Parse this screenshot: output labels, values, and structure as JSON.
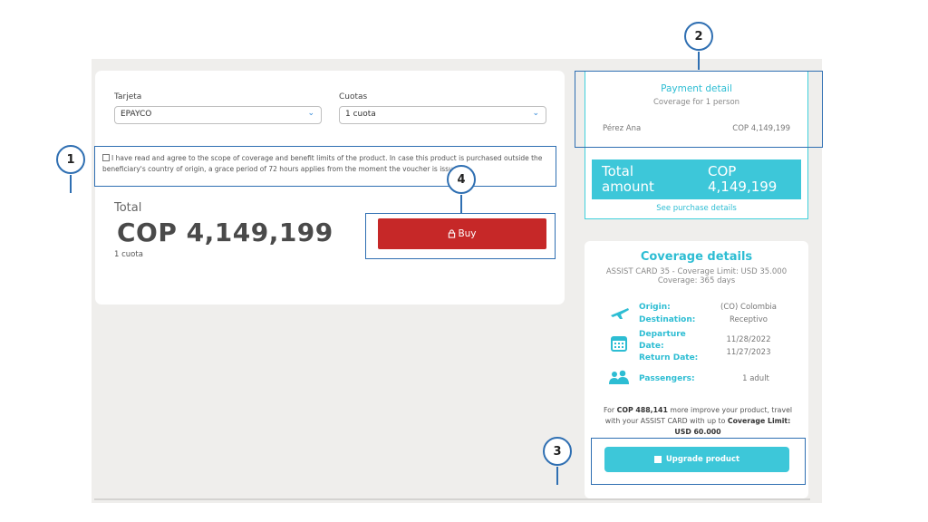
{
  "checkout": {
    "card_label": "Tarjeta",
    "card_value": "EPAYCO",
    "installments_label": "Cuotas",
    "installments_value": "1 cuota",
    "terms_text": "I have read and agree to the scope of coverage and benefit limits of the product. In case this product is purchased outside the beneficiary's country of origin, a grace period of 72 hours applies from the moment the voucher is issued.",
    "total_label": "Total",
    "total_amount": "COP 4,149,199",
    "total_sub": "1 cuota",
    "buy_label": "Buy"
  },
  "payment": {
    "title": "Payment detail",
    "subtitle": "Coverage for 1 person",
    "person_name": "Pérez Ana",
    "person_amount": "COP 4,149,199",
    "total_label": "Total amount",
    "total_value": "COP 4,149,199",
    "see_details": "See purchase details"
  },
  "coverage": {
    "title": "Coverage details",
    "subtitle": "ASSIST CARD 35 - Coverage Limit: USD 35.000 Coverage: 365 days",
    "origin_label": "Origin:",
    "origin_value": "(CO) Colombia",
    "destination_label": "Destination:",
    "destination_value": "Receptivo",
    "departure_label": "Departure Date:",
    "departure_value": "11/28/2022",
    "return_label": "Return Date:",
    "return_value": "11/27/2023",
    "passengers_label": "Passengers:",
    "passengers_value": "1 adult",
    "upsell_pre": "For ",
    "upsell_amount": "COP 488,141",
    "upsell_mid": " more improve your product, travel with your ASSIST CARD with up to ",
    "upsell_limit": "Coverage Limit: USD 60.000",
    "upgrade_label": "Upgrade product"
  },
  "markers": {
    "m1": "1",
    "m2": "2",
    "m3": "3",
    "m4": "4"
  },
  "colors": {
    "accent": "#3dc7d9",
    "buy": "#c62828",
    "highlight": "#2f6fb2"
  },
  "icons": [
    "chevron-down-icon",
    "lock-icon",
    "airplane-icon",
    "calendar-icon",
    "people-icon"
  ]
}
